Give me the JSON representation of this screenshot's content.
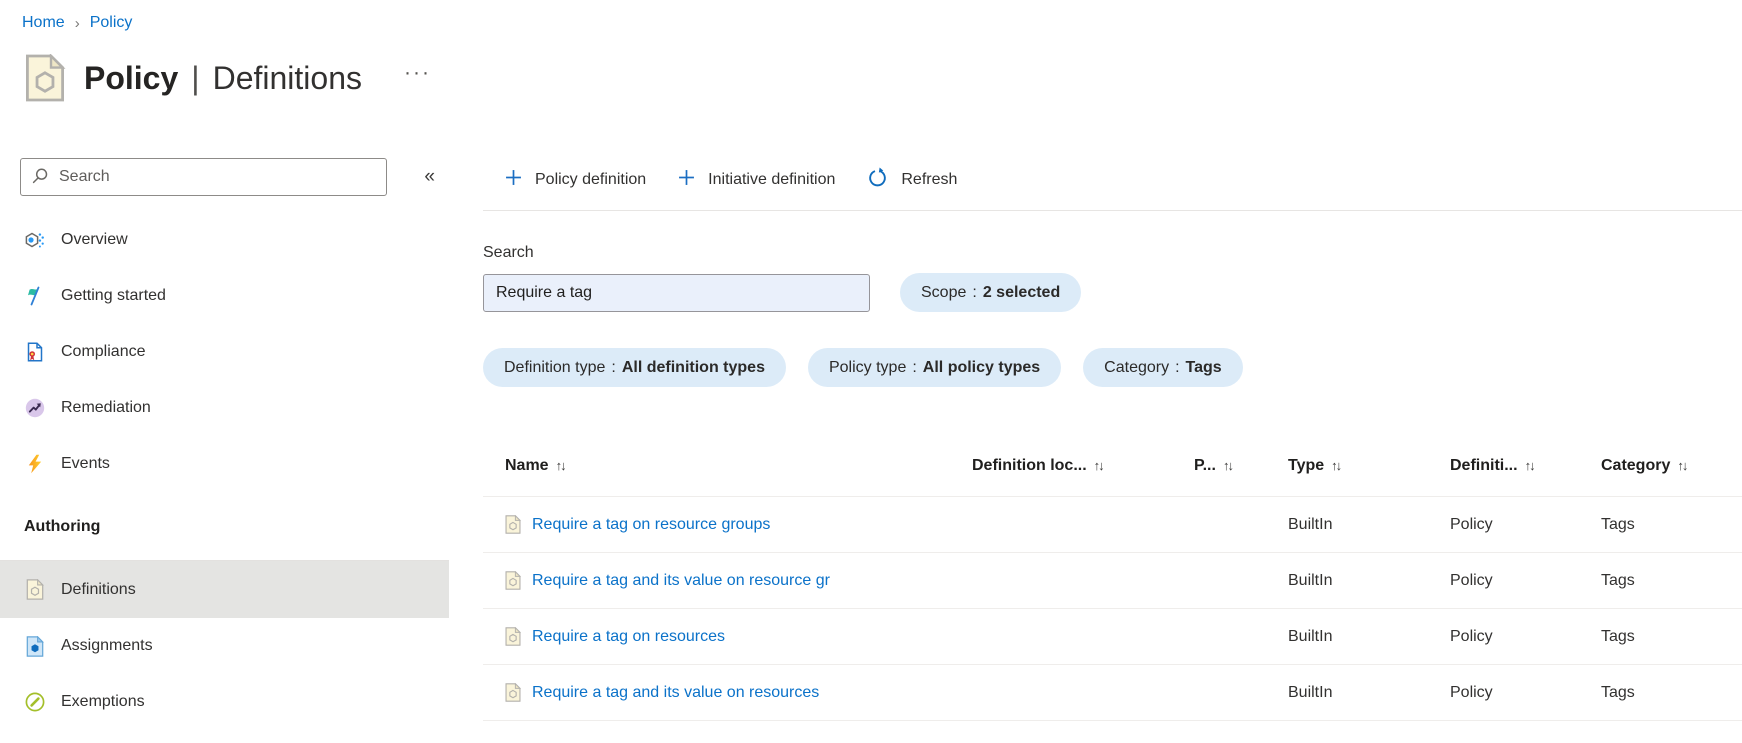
{
  "colors": {
    "accent": "#0078d4",
    "link": "#0b72c9",
    "pill_bg": "#dcebf8",
    "search_input_bg": "#eaf0fb",
    "selected_item_bg": "#e4e4e2",
    "policy_icon_bg": "#faf4da"
  },
  "icons": {
    "sort": "↑↓",
    "collapse": "«",
    "breadcrumb_separator": "›",
    "more": "···"
  },
  "breadcrumb": {
    "items": [
      {
        "label": "Home"
      },
      {
        "label": "Policy"
      }
    ]
  },
  "header": {
    "title": "Policy",
    "separator": "|",
    "subtitle": "Definitions"
  },
  "sidebar": {
    "search": {
      "placeholder": "Search"
    },
    "items": [
      {
        "label": "Overview"
      },
      {
        "label": "Getting started"
      },
      {
        "label": "Compliance"
      },
      {
        "label": "Remediation"
      },
      {
        "label": "Events"
      }
    ],
    "section": {
      "title": "Authoring",
      "items": [
        {
          "label": "Definitions",
          "selected": true
        },
        {
          "label": "Assignments",
          "selected": false
        },
        {
          "label": "Exemptions",
          "selected": false
        }
      ]
    }
  },
  "toolbar": {
    "buttons": [
      {
        "label": "Policy definition"
      },
      {
        "label": "Initiative definition"
      },
      {
        "label": "Refresh"
      }
    ]
  },
  "filters": {
    "search_label": "Search",
    "search_value": "Require a tag",
    "scope_pill": {
      "label": "Scope",
      "separator": ":",
      "value": "2 selected"
    },
    "pills": [
      {
        "label": "Definition type",
        "separator": ":",
        "value": "All definition types"
      },
      {
        "label": "Policy type",
        "separator": ":",
        "value": "All policy types"
      },
      {
        "label": "Category",
        "separator": ":",
        "value": "Tags"
      }
    ]
  },
  "table": {
    "columns": [
      {
        "label": "Name"
      },
      {
        "label": "Definition loc..."
      },
      {
        "label": "P..."
      },
      {
        "label": "Type"
      },
      {
        "label": "Definiti..."
      },
      {
        "label": "Category"
      }
    ],
    "rows": [
      {
        "name": "Require a tag on resource groups",
        "definition_location": "",
        "p": "",
        "type": "BuiltIn",
        "definition_type": "Policy",
        "category": "Tags"
      },
      {
        "name": "Require a tag and its value on resource gr",
        "definition_location": "",
        "p": "",
        "type": "BuiltIn",
        "definition_type": "Policy",
        "category": "Tags"
      },
      {
        "name": "Require a tag on resources",
        "definition_location": "",
        "p": "",
        "type": "BuiltIn",
        "definition_type": "Policy",
        "category": "Tags"
      },
      {
        "name": "Require a tag and its value on resources",
        "definition_location": "",
        "p": "",
        "type": "BuiltIn",
        "definition_type": "Policy",
        "category": "Tags"
      }
    ]
  }
}
